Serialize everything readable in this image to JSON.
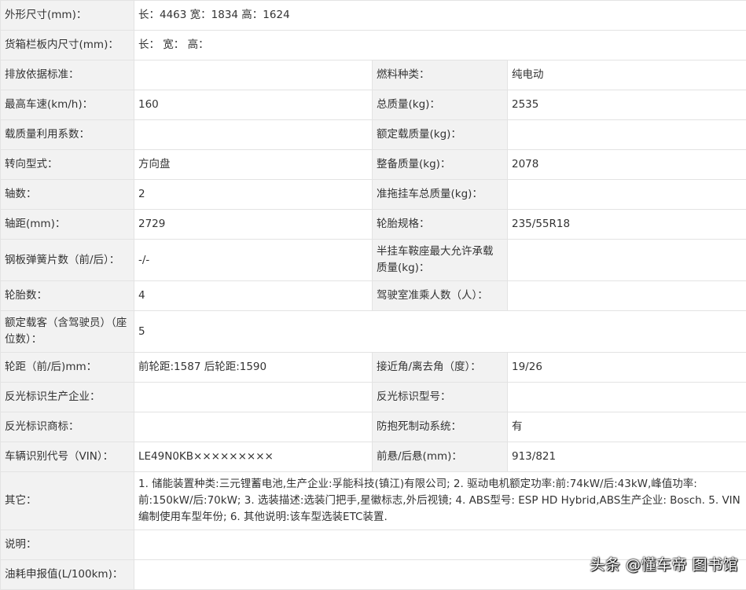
{
  "spec": {
    "r1": {
      "k": "外形尺寸(mm)：",
      "v": "长：4463 宽：1834 高：1624"
    },
    "r2": {
      "k": "货箱栏板内尺寸(mm)：",
      "v": "长：  宽：  高："
    },
    "r3": {
      "k1": "排放依据标准：",
      "v1": "",
      "k2": "燃料种类：",
      "v2": "纯电动"
    },
    "r4": {
      "k1": "最高车速(km/h)：",
      "v1": "160",
      "k2": "总质量(kg)：",
      "v2": "2535"
    },
    "r5": {
      "k1": "载质量利用系数：",
      "v1": "",
      "k2": "额定载质量(kg)：",
      "v2": ""
    },
    "r6": {
      "k1": "转向型式：",
      "v1": "方向盘",
      "k2": "整备质量(kg)：",
      "v2": "2078"
    },
    "r7": {
      "k1": "轴数：",
      "v1": "2",
      "k2": "准拖挂车总质量(kg)：",
      "v2": ""
    },
    "r8": {
      "k1": "轴距(mm)：",
      "v1": "2729",
      "k2": "轮胎规格：",
      "v2": "235/55R18"
    },
    "r9": {
      "k1": "钢板弹簧片数（前/后）：",
      "v1": "-/-",
      "k2": "半挂车鞍座最大允许承载质量(kg)：",
      "v2": ""
    },
    "r10": {
      "k1": "轮胎数：",
      "v1": "4",
      "k2": "驾驶室准乘人数（人）：",
      "v2": ""
    },
    "r11": {
      "k": "额定载客（含驾驶员）（座位数）：",
      "v": "5"
    },
    "r12": {
      "k1": "轮距（前/后)mm：",
      "v1": "前轮距:1587 后轮距:1590",
      "k2": "接近角/离去角（度）：",
      "v2": "19/26"
    },
    "r13": {
      "k1": "反光标识生产企业：",
      "v1": "",
      "k2": "反光标识型号：",
      "v2": ""
    },
    "r14": {
      "k1": "反光标识商标：",
      "v1": "",
      "k2": "防抱死制动系统：",
      "v2": "有"
    },
    "r15": {
      "k1": "车辆识别代号（VIN）：",
      "v1": "LE49N0KB×××××××××",
      "k2": "前悬/后悬(mm)：",
      "v2": "913/821"
    },
    "r16": {
      "k": "其它：",
      "v": "1. 储能装置种类:三元锂蓄电池,生产企业:孚能科技(镇江)有限公司; 2. 驱动电机额定功率:前:74kW/后:43kW,峰值功率:前:150kW/后:70kW; 3. 选装描述:选装门把手,星徽标志,外后视镜; 4. ABS型号: ESP HD Hybrid,ABS生产企业: Bosch. 5. VIN编制使用车型年份; 6. 其他说明:该车型选装ETC装置."
    },
    "r17": {
      "k": "说明：",
      "v": ""
    },
    "r18": {
      "k": "油耗申报值(L/100km)：",
      "v": ""
    }
  },
  "watermark": "头条 @懂车帝 图书馆"
}
